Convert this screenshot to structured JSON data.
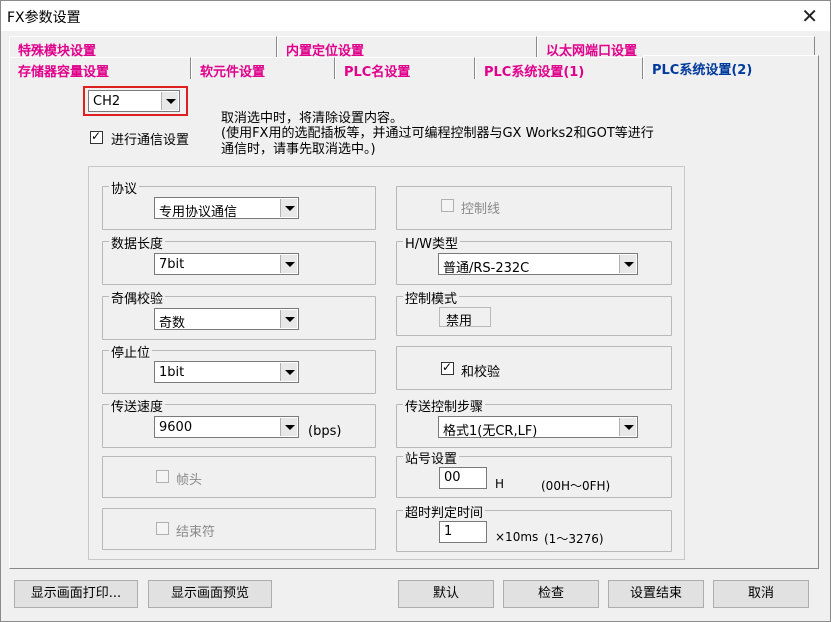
{
  "window": {
    "title": "FX参数设置",
    "close_glyph": "✕"
  },
  "tabs_row1": [
    "特殊模块设置",
    "内置定位设置",
    "以太网端口设置"
  ],
  "tabs_row2": [
    "存储器容量设置",
    "软元件设置",
    "PLC名设置",
    "PLC系统设置(1)",
    "PLC系统设置(2)"
  ],
  "channel": {
    "value": "CH2"
  },
  "comm": {
    "checkbox_label": "进行通信设置",
    "checked": true,
    "note_line1": "取消选中时，将清除设置内容。",
    "note_line2": "(使用FX用的选配插板等，并通过可编程控制器与GX Works2和GOT等进行",
    "note_line3": "通信时，请事先取消选中。)"
  },
  "left": {
    "protocol": {
      "label": "协议",
      "value": "专用协议通信"
    },
    "data_length": {
      "label": "数据长度",
      "value": "7bit"
    },
    "parity": {
      "label": "奇偶校验",
      "value": "奇数"
    },
    "stop_bit": {
      "label": "停止位",
      "value": "1bit"
    },
    "baud": {
      "label": "传送速度",
      "value": "9600",
      "unit": "(bps)"
    },
    "header": {
      "label": "帧头"
    },
    "terminator": {
      "label": "结束符"
    }
  },
  "right": {
    "control_line": {
      "label": "控制线"
    },
    "hw_type": {
      "label": "H/W类型",
      "value": "普通/RS-232C"
    },
    "control_mode": {
      "label": "控制模式",
      "value": "禁用"
    },
    "sum_check": {
      "label": "和校验",
      "checked": true
    },
    "procedure": {
      "label": "传送控制步骤",
      "value": "格式1(无CR,LF)"
    },
    "station": {
      "label": "站号设置",
      "value": "00",
      "suffix": "H",
      "range": "(00H～0FH)"
    },
    "timeout": {
      "label": "超时判定时间",
      "value": "1",
      "unit": "×10ms",
      "range": "(1～3276)"
    }
  },
  "buttons": {
    "print": "显示画面打印...",
    "preview": "显示画面预览",
    "default": "默认",
    "check": "检查",
    "finish": "设置结束",
    "cancel": "取消"
  }
}
